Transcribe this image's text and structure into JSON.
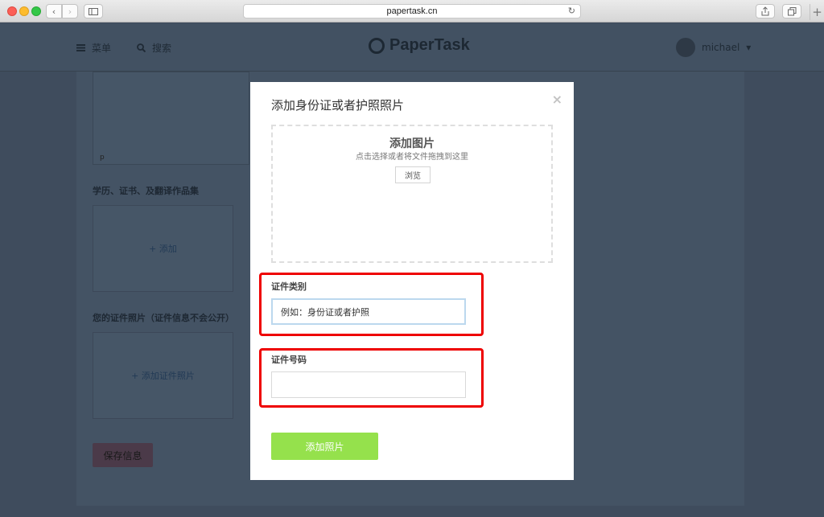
{
  "browser": {
    "url": "papertask.cn",
    "back_icon": "‹",
    "forward_icon": "›",
    "reload_icon": "↻",
    "new_tab_icon": "+"
  },
  "header": {
    "menu_label": "菜单",
    "search_label": "搜索",
    "logo_text": "PaperTask",
    "user_name": "michael",
    "user_caret": "▾"
  },
  "background": {
    "editor_mark": "p",
    "credentials_label": "学历、证书、及翻译作品集",
    "add_link": "+ 添加",
    "id_photo_label": "您的证件照片（证件信息不会公开）",
    "add_id_photo_link": "+ 添加证件照片",
    "save_button": "保存信息"
  },
  "modal": {
    "title": "添加身份证或者护照照片",
    "close": "×",
    "upload_title": "添加图片",
    "upload_hint": "点击选择或者将文件拖拽到这里",
    "browse_button": "浏览",
    "doc_type_label": "证件类别",
    "doc_type_placeholder": "例如：身份证或者护照",
    "doc_number_label": "证件号码",
    "doc_number_value": "",
    "submit_button": "添加照片"
  },
  "colors": {
    "submit_green": "#95e14c",
    "highlight_red": "#e00000",
    "overlay": "#3d4b5c"
  }
}
